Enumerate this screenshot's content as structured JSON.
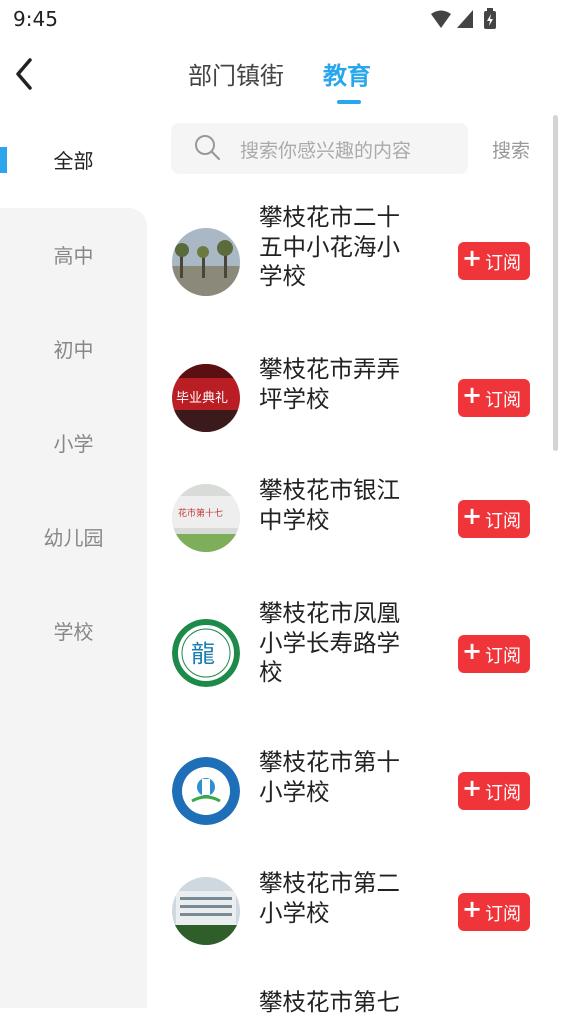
{
  "status_bar": {
    "time": "9:45"
  },
  "header": {
    "tabs": [
      {
        "label": "部门镇街",
        "active": false
      },
      {
        "label": "教育",
        "active": true
      }
    ],
    "accent_color": "#2aa7ec"
  },
  "sidebar": {
    "items": [
      {
        "label": "全部",
        "active": true
      },
      {
        "label": "高中",
        "active": false
      },
      {
        "label": "初中",
        "active": false
      },
      {
        "label": "小学",
        "active": false
      },
      {
        "label": "幼儿园",
        "active": false
      },
      {
        "label": "学校",
        "active": false
      }
    ]
  },
  "search": {
    "placeholder": "搜索你感兴趣的内容",
    "button_label": "搜索",
    "icon": "search-icon"
  },
  "list": {
    "subscribe_color": "#f0353a",
    "items": [
      {
        "line1": "攀枝花市二十",
        "line2": "五中小花海小",
        "line3": "学校",
        "button": "订阅",
        "avatar": "campus-photo"
      },
      {
        "line1": "攀枝花市弄弄",
        "line2": "坪学校",
        "line3": "",
        "button": "订阅",
        "avatar": "graduation-banner-photo"
      },
      {
        "line1": "攀枝花市银江",
        "line2": "中学校",
        "line3": "",
        "button": "订阅",
        "avatar": "school-sign-photo"
      },
      {
        "line1": "攀枝花市凤凰",
        "line2": "小学长寿路学",
        "line3": "校",
        "button": "订阅",
        "avatar": "school-emblem-green"
      },
      {
        "line1": "攀枝花市第十",
        "line2": "小学校",
        "line3": "",
        "button": "订阅",
        "avatar": "school-emblem-blue"
      },
      {
        "line1": "攀枝花市第二",
        "line2": "小学校",
        "line3": "",
        "button": "订阅",
        "avatar": "school-building-photo"
      },
      {
        "line1": "攀枝花市第七",
        "line2": "",
        "line3": "",
        "button": "",
        "avatar": ""
      }
    ]
  }
}
